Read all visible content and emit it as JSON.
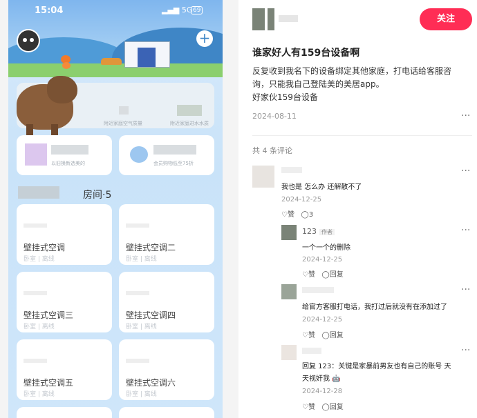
{
  "phone": {
    "time": "15:04",
    "signal": "5G",
    "battery": "69",
    "section_title": "房间·5",
    "cards": {
      "card1_caption": "附近家庭空气质量",
      "card2_caption": "附近家庭进水水质",
      "promo1_caption": "以旧换新选美的",
      "promo2_caption": "会员购物低至75折"
    },
    "rooms": [
      {
        "name": "壁挂式空调",
        "sub": "卧室 | 离线"
      },
      {
        "name": "壁挂式空调二",
        "sub": "卧室 | 离线"
      },
      {
        "name": "壁挂式空调三",
        "sub": "卧室 | 离线"
      },
      {
        "name": "壁挂式空调四",
        "sub": "卧室 | 离线"
      },
      {
        "name": "壁挂式空调五",
        "sub": "卧室 | 离线"
      },
      {
        "name": "壁挂式空调六",
        "sub": "卧室 | 离线"
      }
    ]
  },
  "post": {
    "follow_label": "关注",
    "title": "谁家好人有159台设备啊",
    "body_line1": "反复收到我名下的设备绑定其他家庭，打电话给客服咨",
    "body_line2": "询，只能我自己登陆美的美居app。",
    "body_line3": "好家伙159台设备",
    "date": "2024-08-11",
    "more": "···",
    "comment_count": "共 4 条评论"
  },
  "comments": [
    {
      "text": "我也是 怎么办 还解散不了",
      "date": "2024-12-25",
      "likes": "♡赞",
      "replies": "◯3"
    },
    {
      "author": "123",
      "tag": "作者",
      "text": "一个一个的删除",
      "date": "2024-12-25",
      "likes": "♡赞",
      "replies": "◯回复"
    },
    {
      "text": "给官方客服打电话，我打过后就没有在添加过了",
      "date": "2024-12-25",
      "likes": "♡赞",
      "replies": "◯回复"
    },
    {
      "text": "回复 123：关键是家暴前男友也有自己的账号 天",
      "text2": "天视奸我 🤖",
      "date": "2024-12-28",
      "likes": "♡赞",
      "replies": "◯回复"
    }
  ],
  "colors": {
    "accent": "#ff2d55",
    "sky": "#7fb6ee"
  }
}
